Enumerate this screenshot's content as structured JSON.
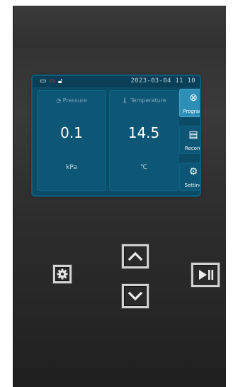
{
  "status": {
    "datetime": "2023-03-04  11 10",
    "icons": [
      "tray-icon",
      "tray-red-icon",
      "lock-icon"
    ]
  },
  "pressure": {
    "label": "Pressure",
    "value": "0.1",
    "unit": "kPa",
    "icon": "gauge-icon"
  },
  "temperature": {
    "label": "Temperature",
    "value": "14.5",
    "unit": "℃",
    "icon": "thermometer-icon"
  },
  "side_menu": {
    "program": "Program",
    "record": "Record",
    "setting": "Setting"
  },
  "colors": {
    "screen_bg": "#0b4b67",
    "card_bg": "#0d5676",
    "active_btn": "#2d8fb6",
    "alert_red": "#e2322e"
  }
}
